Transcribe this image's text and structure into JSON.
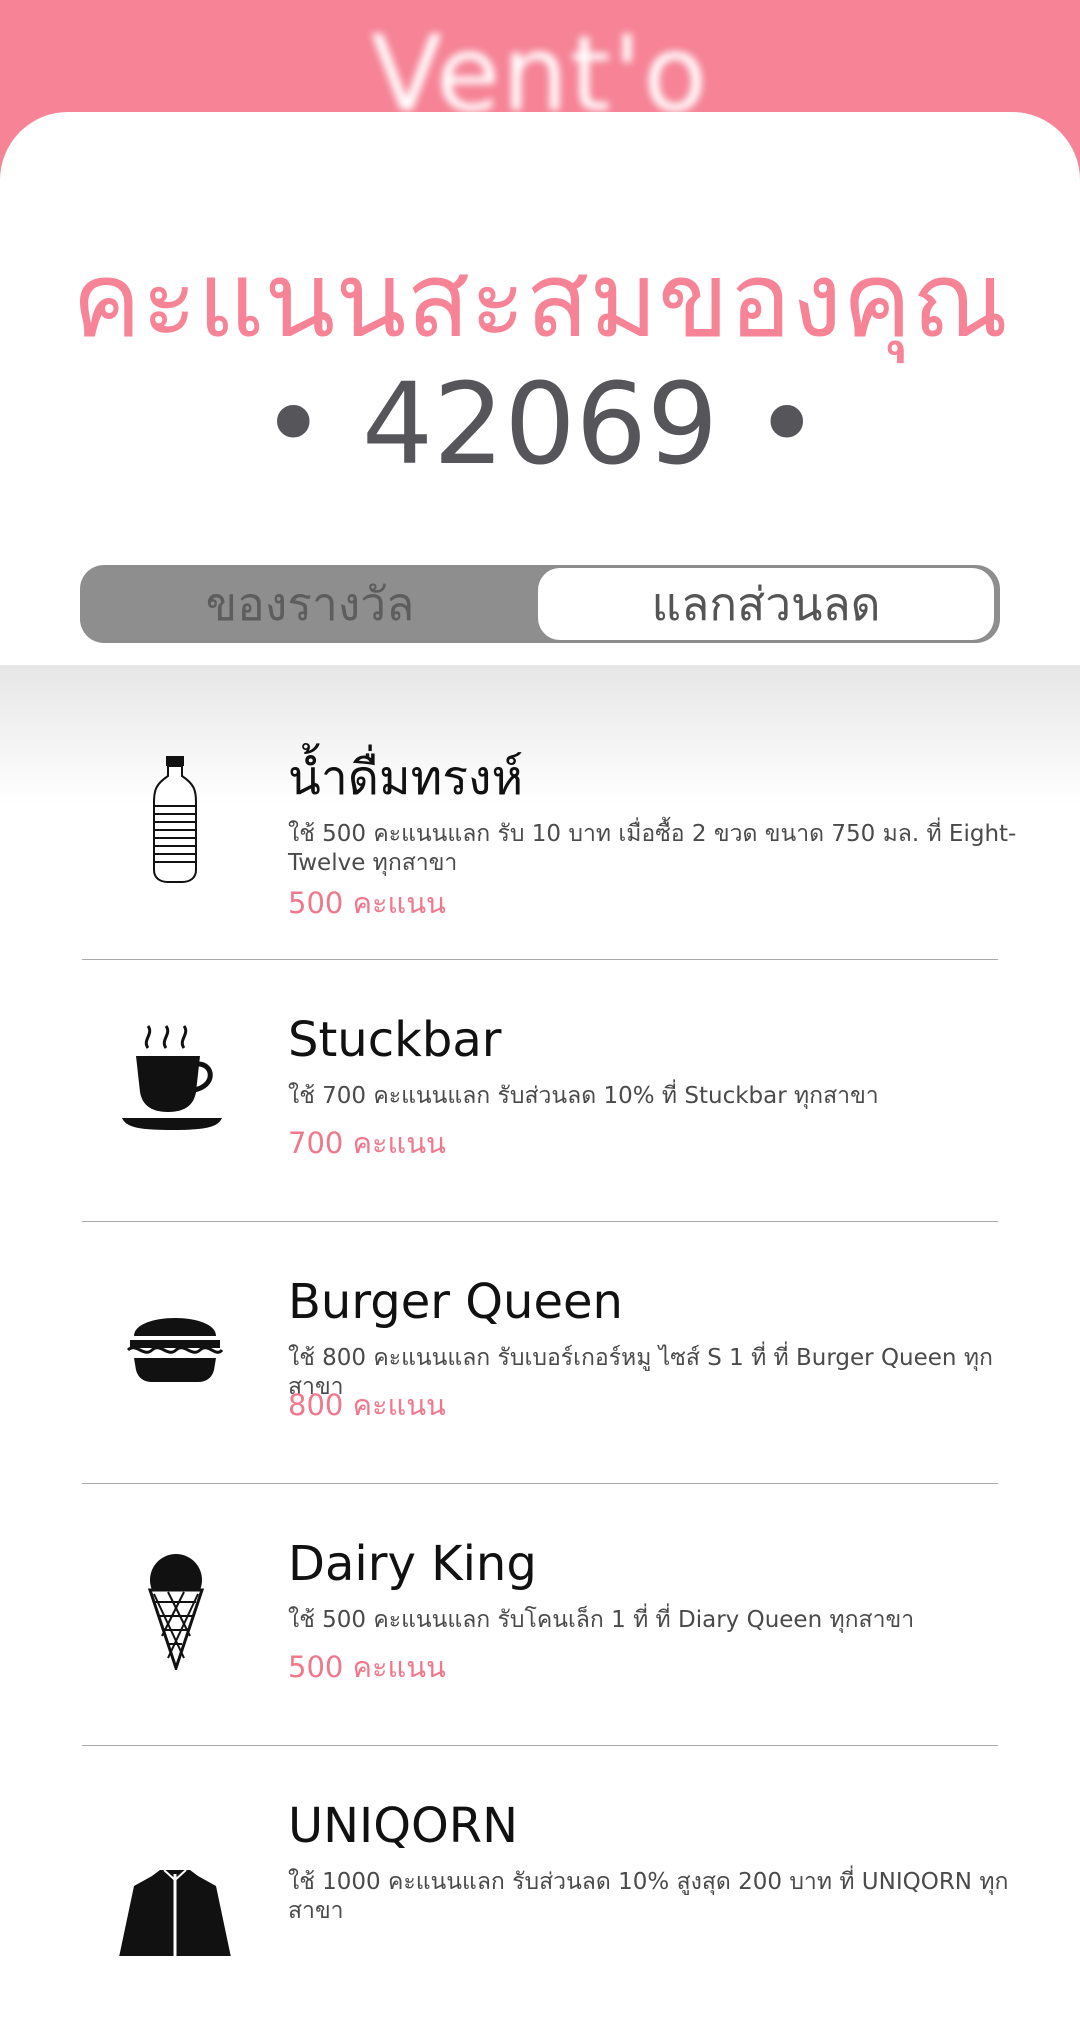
{
  "header": {
    "brand": "Vent'o"
  },
  "score": {
    "title": "คะแนนสะสมของคุณ",
    "value": "• 42069 •"
  },
  "tabs": [
    {
      "label": "ของรางวัล",
      "active": false
    },
    {
      "label": "แลกส่วนลด",
      "active": true
    }
  ],
  "items": [
    {
      "name": "น้ำดื่มทรงห์",
      "desc": "ใช้ 500 คะแนนแลก รับ 10 บาท เมื่อซื้อ 2 ขวด ขนาด 750 มล. ที่ Eight-Twelve ทุกสาขา",
      "points": "500 คะแนน",
      "icon": "water-bottle-icon"
    },
    {
      "name": "Stuckbar",
      "desc": "ใช้ 700 คะแนนแลก รับส่วนลด 10% ที่ Stuckbar ทุกสาขา",
      "points": "700 คะแนน",
      "icon": "coffee-cup-icon"
    },
    {
      "name": "Burger Queen",
      "desc": "ใช้ 800 คะแนนแลก รับเบอร์เกอร์หมู ไซส์ S 1 ที่ ที่ Burger Queen ทุกสาขา",
      "points": "800 คะแนน",
      "icon": "burger-icon"
    },
    {
      "name": "Dairy King",
      "desc": "ใช้ 500 คะแนนแลก รับโคนเล็ก 1 ที่ ที่ Diary Queen ทุกสาขา",
      "points": "500 คะแนน",
      "icon": "ice-cream-cone-icon"
    },
    {
      "name": "UNIQORN",
      "desc": "ใช้ 1000 คะแนนแลก รับส่วนลด 10% สูงสุด 200 บาท ที่ UNIQORN ทุกสาขา",
      "points": "",
      "icon": "jacket-icon"
    }
  ],
  "colors": {
    "accent": "#f68396",
    "tab_bg": "#8e8e8e",
    "score_text": "#55555a"
  }
}
